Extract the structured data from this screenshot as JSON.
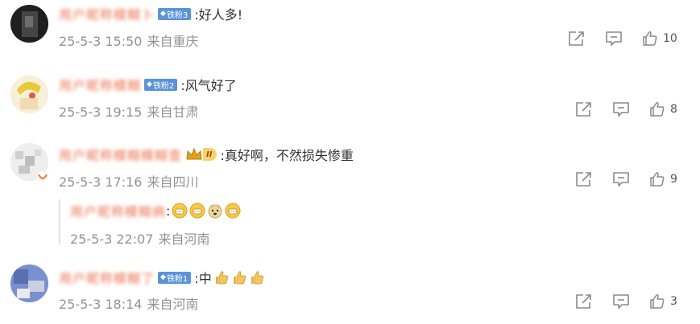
{
  "comments": [
    {
      "username": "用户昵称模糊卜",
      "badge": "铁粉3",
      "text": ":好人多!",
      "date": "25-5-3 15:50",
      "location": "来自重庆",
      "likes": "10"
    },
    {
      "username": "用户昵称模糊",
      "badge": "铁粉2",
      "text": ":风气好了",
      "date": "25-5-3 19:15",
      "location": "来自甘肃",
      "likes": "8"
    },
    {
      "username": "用户昵称模糊模糊查",
      "badge": "II",
      "text": ":真好啊，不然损失惨重",
      "date": "25-5-3 17:16",
      "location": "来自四川",
      "likes": "9",
      "reply": {
        "username": "用户昵称模糊病",
        "text": ":",
        "date": "25-5-3 22:07",
        "location": "来自河南"
      }
    },
    {
      "username": "用户昵称模糊了",
      "badge": "铁粉1",
      "text": ":中",
      "date": "25-5-3 18:14",
      "location": "来自河南",
      "likes": "3"
    }
  ],
  "icons": {
    "share": "share-icon",
    "comment": "comment-icon",
    "like": "thumbs-up-icon",
    "badge": "diamond-icon",
    "crown": "crown-icon"
  },
  "colors": {
    "username": "#eb7350",
    "badge": "#5b93db",
    "meta": "#939393",
    "text": "#333333"
  }
}
